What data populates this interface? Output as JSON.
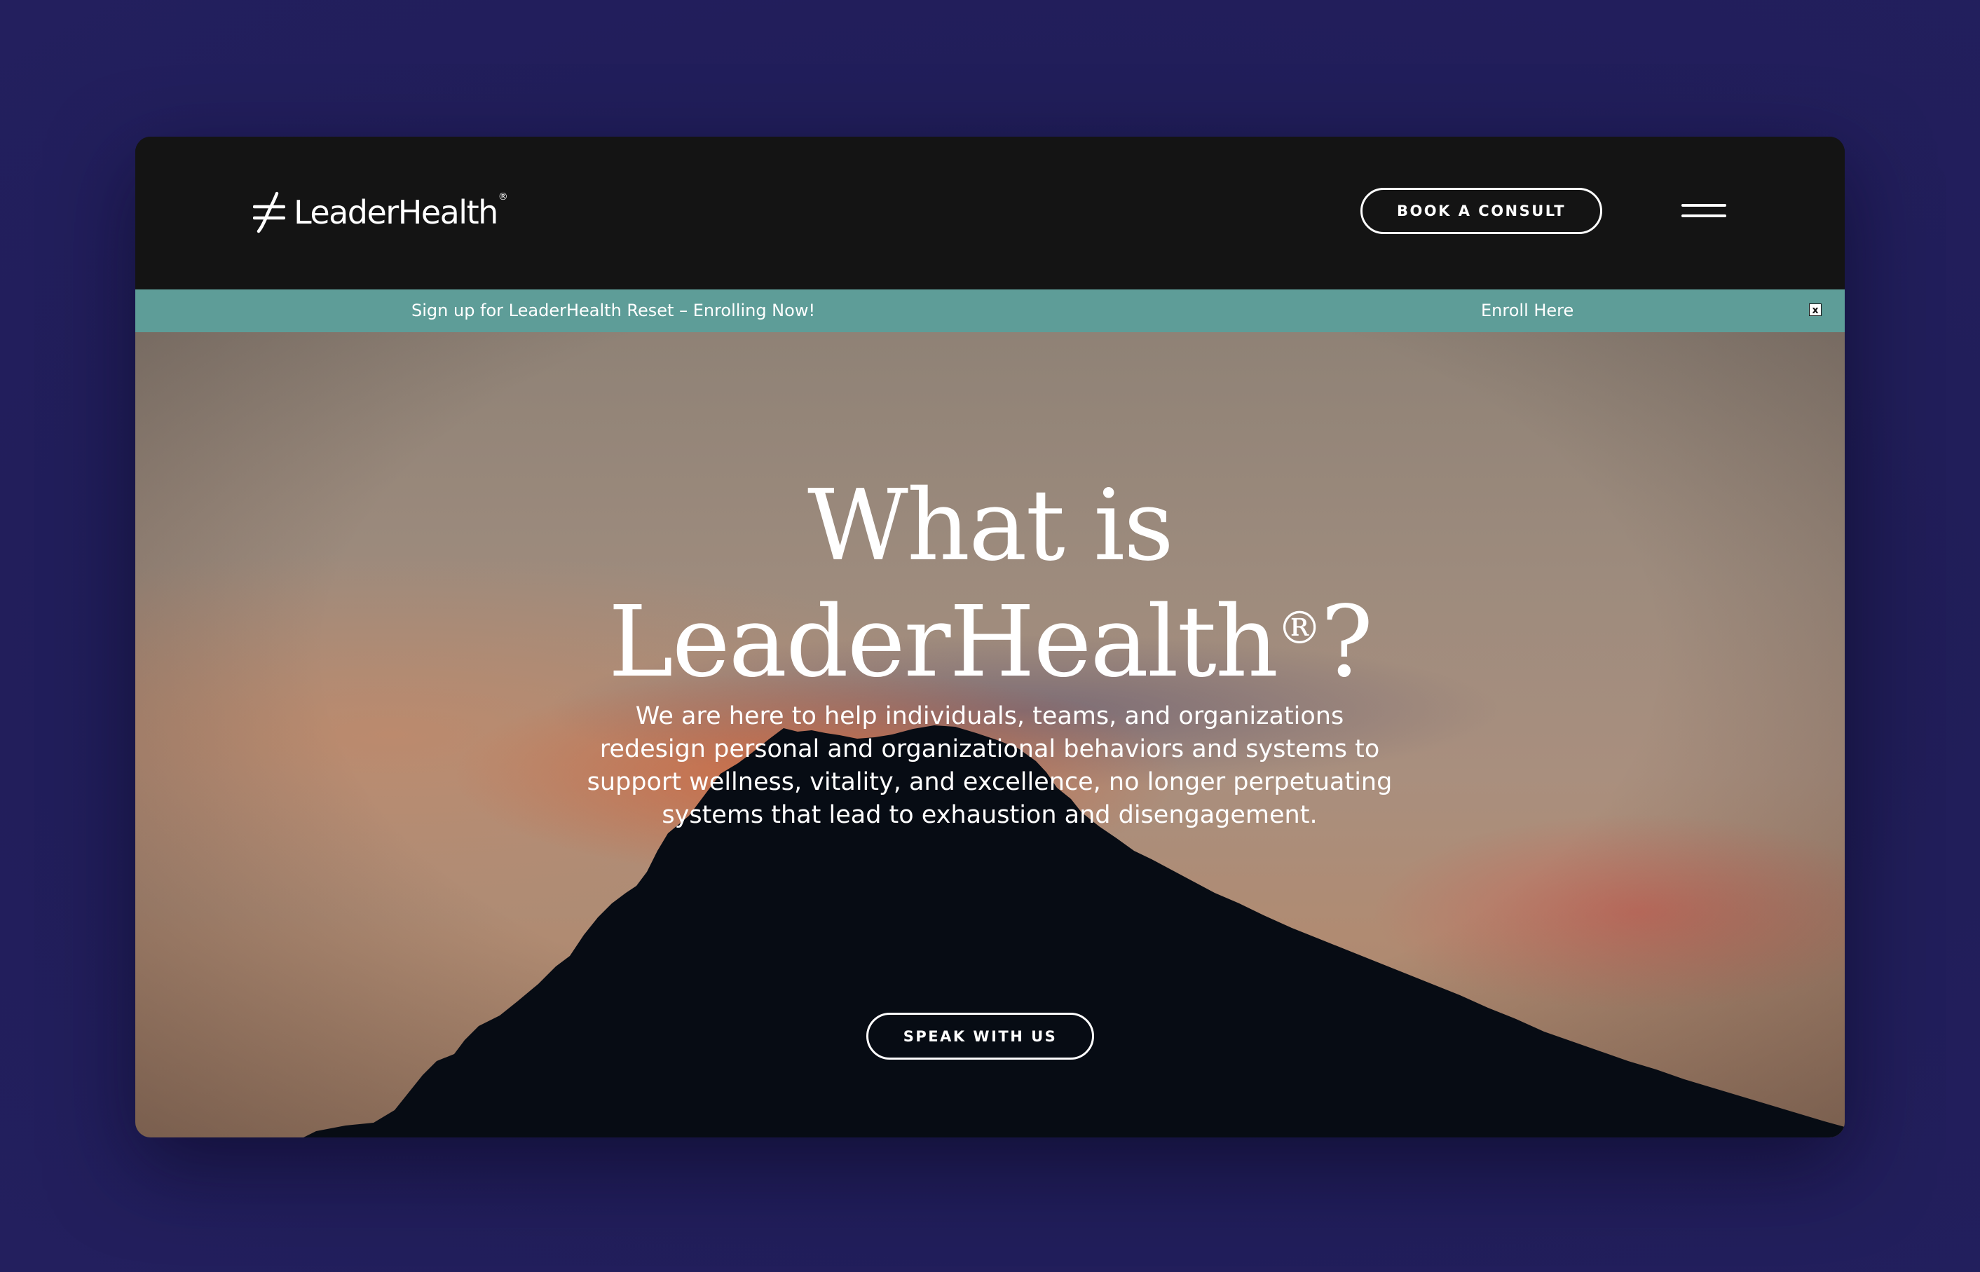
{
  "header": {
    "logo_text": "LeaderHealth",
    "logo_reg": "®",
    "book_label": "BOOK A CONSULT",
    "menu_icon": "hamburger-menu-icon"
  },
  "announcement": {
    "text": "Sign up for LeaderHealth Reset – Enrolling Now!",
    "link_label": "Enroll Here",
    "close_label": "x"
  },
  "hero": {
    "title_line1": "What is",
    "title_line2": "LeaderHealth",
    "title_reg": "®",
    "title_suffix": "?",
    "description": "We are here to help individuals, teams, and organizations redesign personal and organizational behaviors and systems to support wellness, vitality, and excellence, no longer perpetuating systems that lead to exhaustion and disengagement.",
    "cta_label": "SPEAK WITH US"
  },
  "colors": {
    "page_bg": "#211e5a",
    "header_bg": "#141414",
    "announcement_bg": "#5e9d98",
    "text": "#ffffff"
  }
}
